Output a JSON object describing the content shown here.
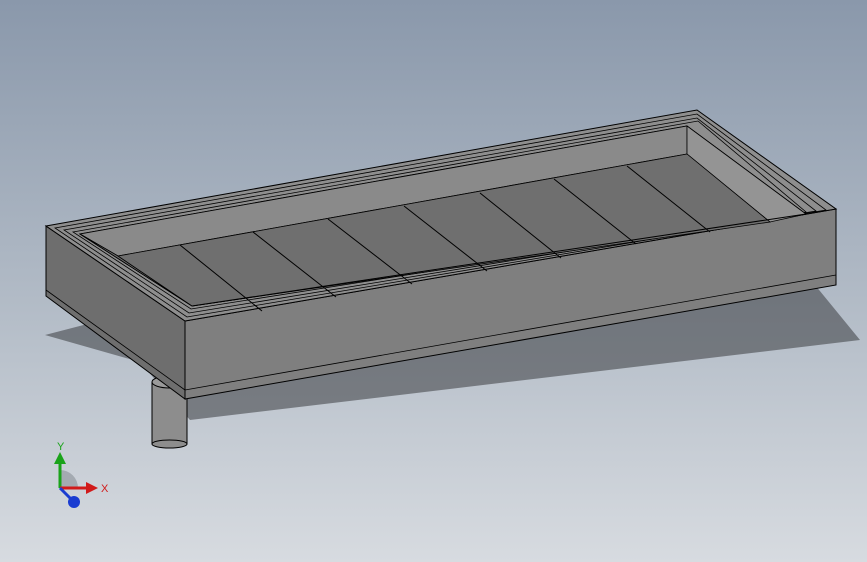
{
  "viewport": {
    "background_top": "#8a98ab",
    "background_bottom": "#d7dbe0"
  },
  "model": {
    "body_color": "#7d7d7d",
    "top_face_color": "#8c8c8c",
    "floor_color": "#6f6f6f",
    "edge_color": "#000000",
    "shadow_color": "#2b2d31",
    "slat_count": 8,
    "support_post_count": 1
  },
  "triad": {
    "x_label": "X",
    "y_label": "Y",
    "x_color": "#d11a1a",
    "y_color": "#1aa31a",
    "z_color": "#1a3cd1",
    "icon": "coordinate-triad-icon"
  }
}
